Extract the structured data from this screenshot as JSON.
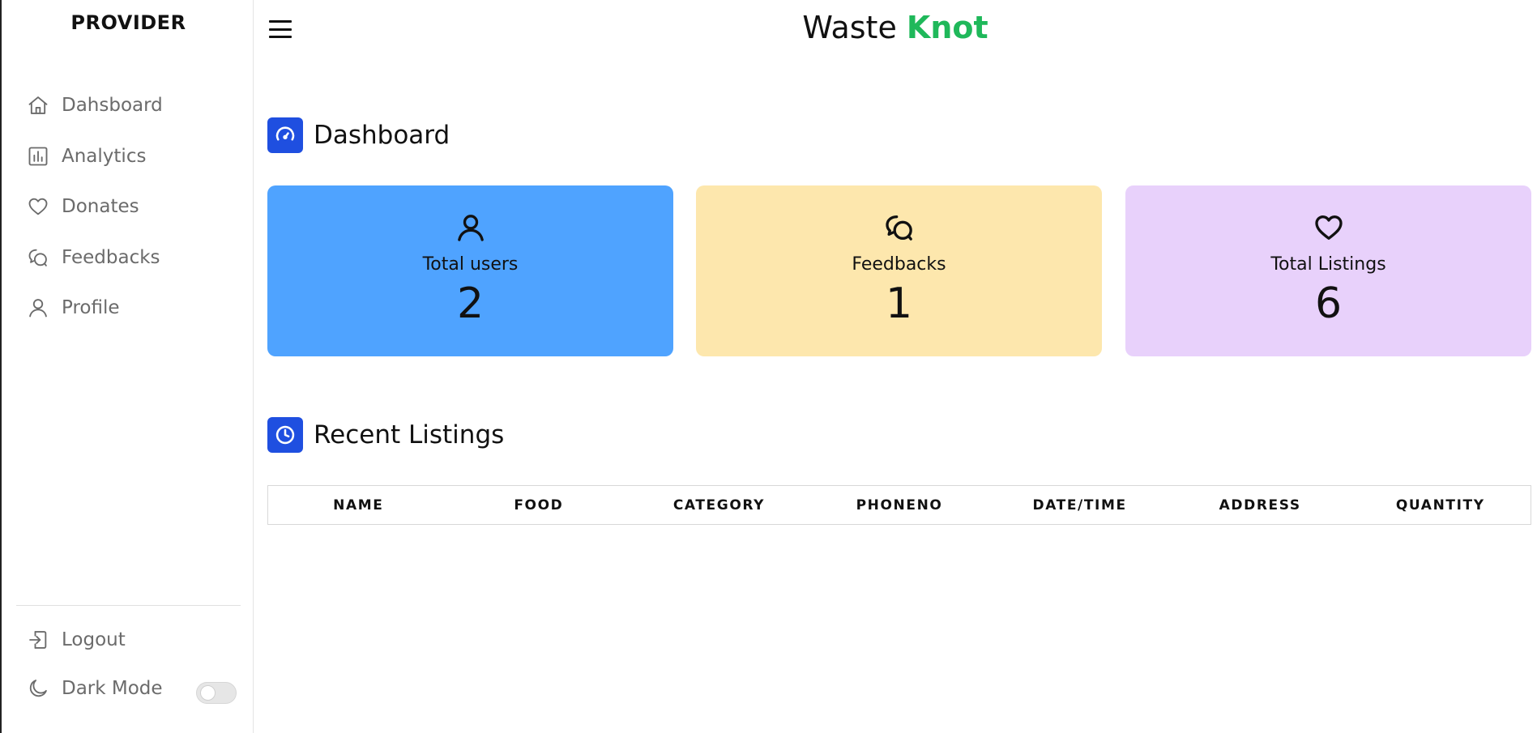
{
  "sidebar": {
    "brand": "PROVIDER",
    "items": [
      {
        "label": "Dahsboard",
        "icon": "home-icon"
      },
      {
        "label": "Analytics",
        "icon": "bar-chart-icon"
      },
      {
        "label": "Donates",
        "icon": "heart-icon"
      },
      {
        "label": "Feedbacks",
        "icon": "chat-bubbles-icon"
      },
      {
        "label": "Profile",
        "icon": "user-icon"
      }
    ],
    "logout_label": "Logout",
    "dark_mode_label": "Dark Mode",
    "dark_mode_on": false
  },
  "header": {
    "title_part1": "Waste ",
    "title_part2": "Knot"
  },
  "dashboard": {
    "heading": "Dashboard",
    "cards": [
      {
        "label": "Total users",
        "value": "2",
        "icon": "user-icon",
        "color": "#4fa3ff"
      },
      {
        "label": "Feedbacks",
        "value": "1",
        "icon": "chat-bubbles-icon",
        "color": "#fde7ad"
      },
      {
        "label": "Total Listings",
        "value": "6",
        "icon": "heart-icon",
        "color": "#e8d1fb"
      }
    ]
  },
  "recent": {
    "heading": "Recent Listings",
    "columns": [
      "NAME",
      "FOOD",
      "CATEGORY",
      "PHONENO",
      "DATE/TIME",
      "ADDRESS",
      "QUANTITY"
    ]
  },
  "colors": {
    "accent_blue": "#1f4fe0",
    "brand_green": "#1fb85a"
  }
}
